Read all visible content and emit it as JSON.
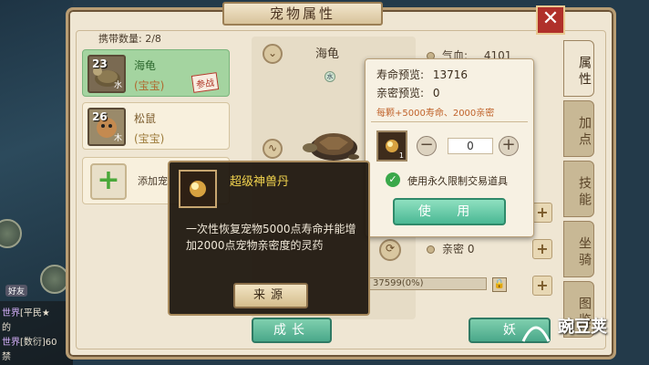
{
  "window": {
    "title": "宠物属性",
    "close": "✕"
  },
  "pet_list": {
    "count_label": "携带数量: 2/8",
    "pets": [
      {
        "level": "23",
        "element": "水",
        "name": "海龟",
        "type": "(宝宝)",
        "tag": "参战"
      },
      {
        "level": "26",
        "element": "木",
        "name": "松鼠",
        "type": "(宝宝)"
      }
    ],
    "add_label": "添加宠"
  },
  "pet_view": {
    "name": "海龟",
    "element_badge": "水"
  },
  "stats": {
    "hp_label": "气血:",
    "hp_value": "4101",
    "intimacy_label": "亲密",
    "intimacy_value": "0",
    "exp_text": "37599(0%)"
  },
  "life_panel": {
    "life_preview_label": "寿命预览:",
    "life_preview_value": "13716",
    "intimacy_preview_label": "亲密预览:",
    "intimacy_preview_value": "0",
    "hint": "每颗+5000寿命、2000亲密",
    "item_count": "1",
    "quantity": "0",
    "use_restricted_label": "使用永久限制交易道具",
    "use_button": "使 用"
  },
  "tooltip": {
    "title": "超级神兽丹",
    "desc": "一次性恢复宠物5000点寿命并能增加2000点宠物亲密度的灵药",
    "source_button": "来源"
  },
  "right_tabs": [
    "属性",
    "加点",
    "技能",
    "坐骑",
    "图鉴"
  ],
  "bottom_buttons": {
    "growth": "成长",
    "demon": "妖"
  },
  "chat": {
    "lines": [
      {
        "channel": "世界",
        "text": "[平民★"
      },
      {
        "channel": "",
        "text": "的"
      },
      {
        "channel": "世界",
        "text": "[数衍]60"
      },
      {
        "channel": "",
        "text": "禁"
      }
    ],
    "friend_label": "好友"
  },
  "watermark": "豌豆荚",
  "colors": {
    "accent_green": "#4aa88a",
    "frame_border": "#b89d74",
    "tooltip_title": "#f2d44e",
    "close_red": "#b0302a"
  }
}
